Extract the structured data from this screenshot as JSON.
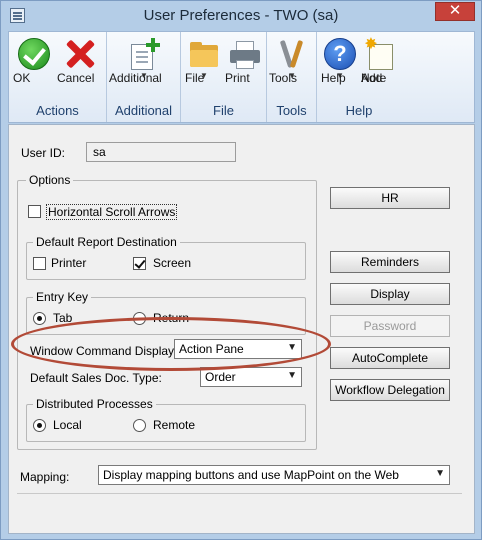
{
  "window": {
    "title": "User Preferences  -  TWO (sa)",
    "close_glyph": "✕"
  },
  "ribbon": {
    "groups": [
      {
        "label": "Actions",
        "buttons": [
          {
            "label": "OK",
            "icon": "ok-icon"
          },
          {
            "label": "Cancel",
            "icon": "cancel-icon"
          }
        ]
      },
      {
        "label": "Additional",
        "buttons": [
          {
            "label": "Additional",
            "icon": "additional-icon",
            "dropdown": true
          }
        ]
      },
      {
        "label": "File",
        "buttons": [
          {
            "label": "File",
            "icon": "folder-icon",
            "dropdown": true
          },
          {
            "label": "Print",
            "icon": "printer-icon"
          }
        ]
      },
      {
        "label": "Tools",
        "buttons": [
          {
            "label": "Tools",
            "icon": "tools-icon",
            "dropdown": true
          }
        ]
      },
      {
        "label": "Help",
        "buttons": [
          {
            "label": "Help",
            "icon": "help-icon",
            "dropdown": true
          },
          {
            "label": "Add\nNote",
            "icon": "add-note-icon"
          }
        ]
      }
    ],
    "ok": "OK",
    "cancel": "Cancel",
    "additional": "Additional",
    "file": "File",
    "print": "Print",
    "tools": "Tools",
    "help": "Help",
    "add": "Add",
    "note": "Note",
    "group_actions": "Actions",
    "group_additional": "Additional",
    "group_file": "File",
    "group_tools": "Tools",
    "group_help": "Help",
    "help_glyph": "?",
    "dropdown_arrow": "▼",
    "star_glyph": "✸"
  },
  "form": {
    "user_id_label": "User ID:",
    "user_id_value": "sa",
    "options_legend": "Options",
    "horizontal_scroll_arrows": {
      "label": "Horizontal Scroll Arrows",
      "checked": false
    },
    "default_report_destination": {
      "legend": "Default Report Destination",
      "printer": {
        "label": "Printer",
        "checked": false
      },
      "screen": {
        "label": "Screen",
        "checked": true
      }
    },
    "entry_key": {
      "legend": "Entry Key",
      "tab": {
        "label": "Tab",
        "selected": true
      },
      "return": {
        "label": "Return",
        "selected": false
      }
    },
    "window_command_display": {
      "label": "Window Command Display",
      "value": "Action Pane"
    },
    "default_sales_doc_type": {
      "label": "Default Sales Doc. Type:",
      "value": "Order"
    },
    "distributed_processes": {
      "legend": "Distributed Processes",
      "local": {
        "label": "Local",
        "selected": true
      },
      "remote": {
        "label": "Remote",
        "selected": false
      }
    },
    "mapping": {
      "label": "Mapping:",
      "value": "Display mapping buttons and use MapPoint on the Web"
    },
    "dropdown_arrow": "▼"
  },
  "side_buttons": {
    "hr": "HR",
    "reminders": "Reminders",
    "display": "Display",
    "password": "Password",
    "autocomplete": "AutoComplete",
    "workflow_delegation": "Workflow Delegation"
  },
  "colors": {
    "window_frame": "#b4cde7",
    "highlight_oval": "#b24a37",
    "close_button": "#c7413a"
  }
}
